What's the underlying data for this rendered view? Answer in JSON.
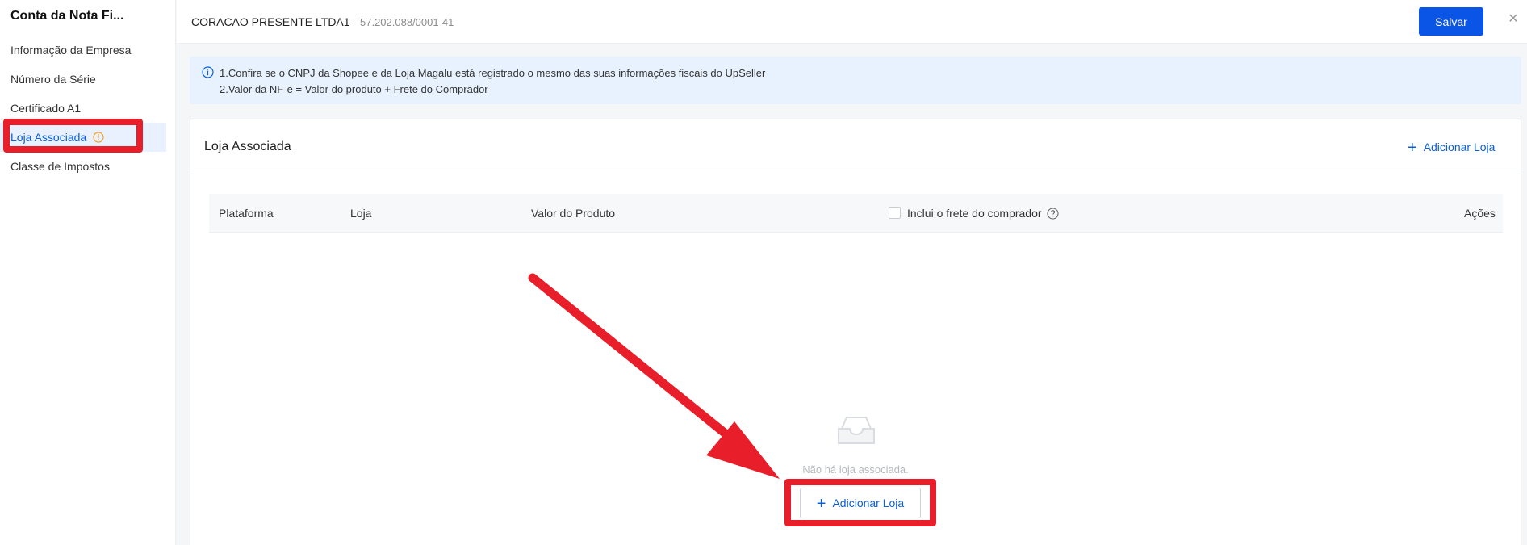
{
  "sidebar": {
    "title": "Conta da Nota Fi...",
    "items": [
      {
        "label": "Informação da Empresa"
      },
      {
        "label": "Número da Série"
      },
      {
        "label": "Certificado A1"
      },
      {
        "label": "Loja Associada",
        "active": true,
        "icon": "info-circle-icon"
      },
      {
        "label": "Classe de Impostos"
      }
    ]
  },
  "header": {
    "company": "CORACAO PRESENTE LTDA1",
    "cnpj": "57.202.088/0001-41",
    "save_label": "Salvar",
    "close_icon": "close-icon"
  },
  "alert": {
    "line1": "1.Confira se o CNPJ da Shopee e da Loja Magalu está registrado o mesmo das suas informações fiscais do UpSeller",
    "line2": "2.Valor da NF-e = Valor do produto + Frete do Comprador"
  },
  "card": {
    "title": "Loja Associada",
    "add_label": "Adicionar Loja",
    "columns": {
      "platform": "Plataforma",
      "store": "Loja",
      "product_value": "Valor do Produto",
      "include_shipping": "Inclui o frete do comprador",
      "actions": "Ações"
    },
    "empty_text": "Não há loja associada.",
    "empty_add_label": "Adicionar Loja"
  },
  "colors": {
    "primary": "#0a55e6",
    "link": "#0c5fd6",
    "annotation_red": "#e81f2a",
    "info_orange": "#f0a020"
  }
}
